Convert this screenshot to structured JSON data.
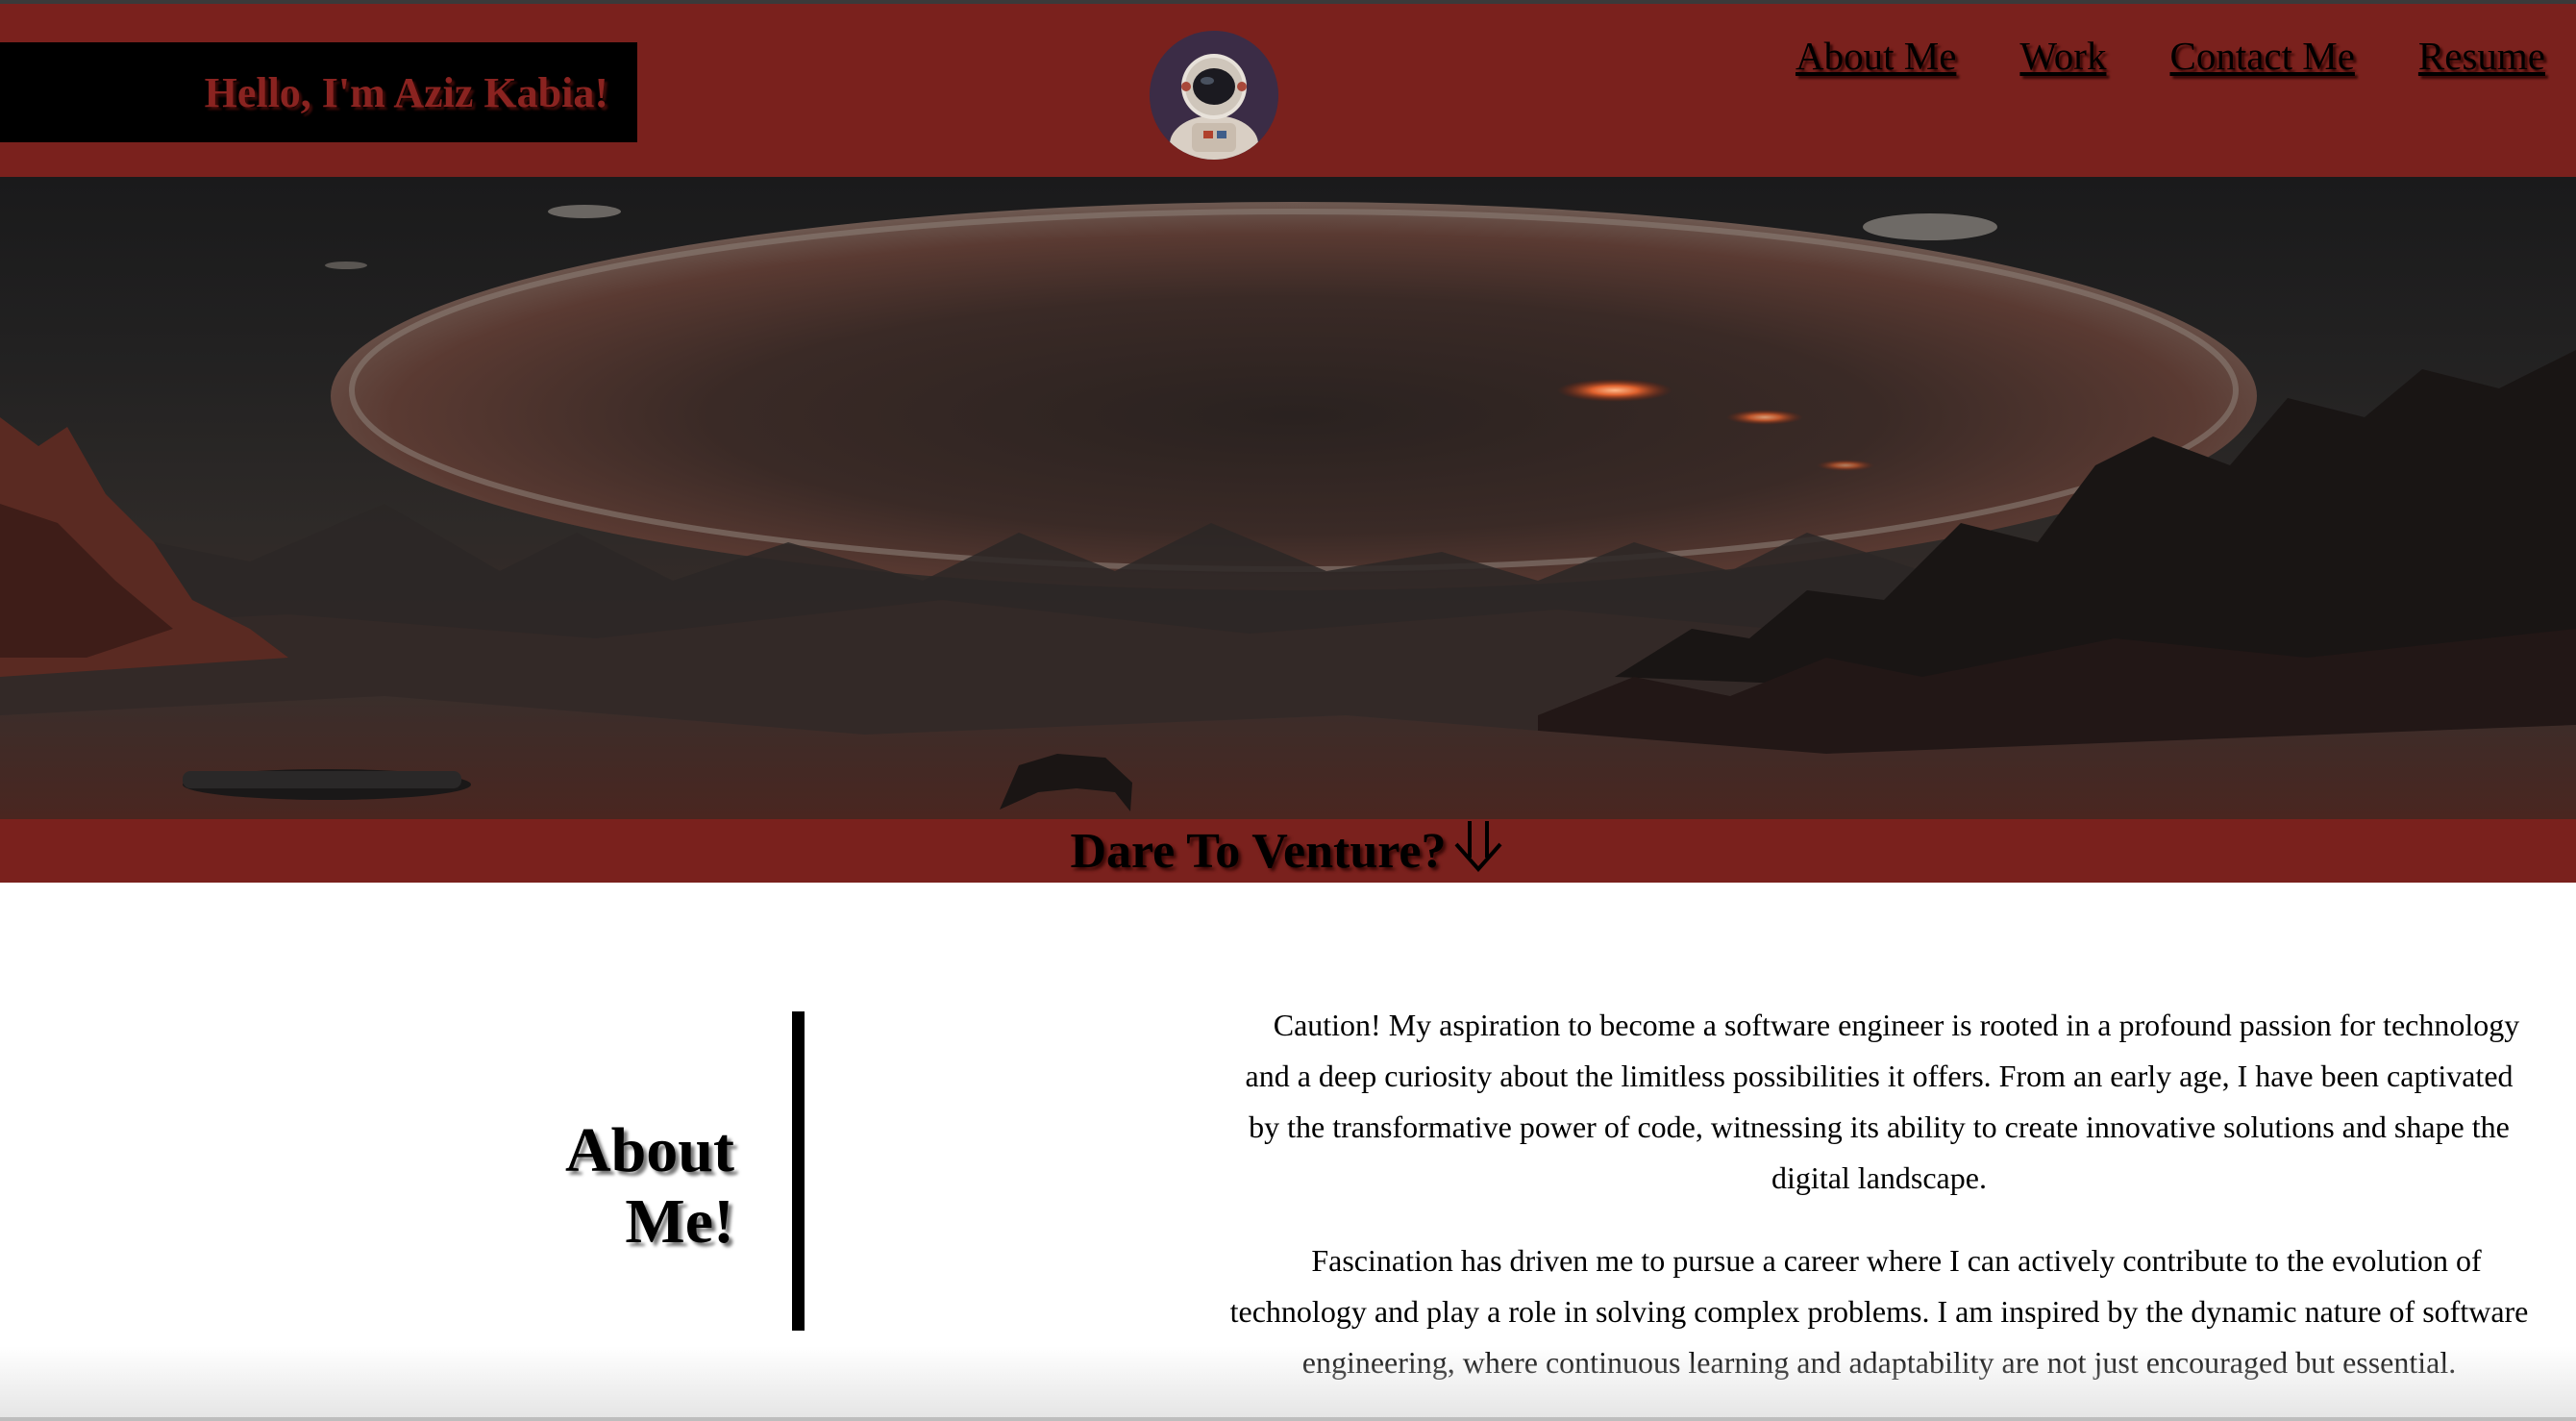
{
  "header": {
    "greeting": "Hello, I'm Aziz Kabia!",
    "nav": [
      {
        "label": "About Me"
      },
      {
        "label": "Work"
      },
      {
        "label": "Contact Me"
      },
      {
        "label": "Resume"
      }
    ]
  },
  "banner": {
    "text": "Dare To Venture?",
    "arrow_icon": "double-down-arrow-icon"
  },
  "about": {
    "heading_line1": "About",
    "heading_line2": "Me!",
    "paragraphs": [
      "Caution! My aspiration to become a software engineer is rooted in a profound passion for technology and a deep curiosity about the limitless possibilities it offers. From an early age, I have been captivated by the transformative power of code, witnessing its ability to create innovative solutions and shape the digital landscape.",
      "Fascination has driven me to pursue a career where I can actively contribute to the evolution of technology and play a role in solving complex problems. I am inspired by the dynamic nature of software engineering, where continuous learning and adaptability are not just encouraged but essential."
    ]
  },
  "colors": {
    "accent": "#7a211d",
    "header_box": "#000000",
    "greeting_text": "#8a2320"
  }
}
